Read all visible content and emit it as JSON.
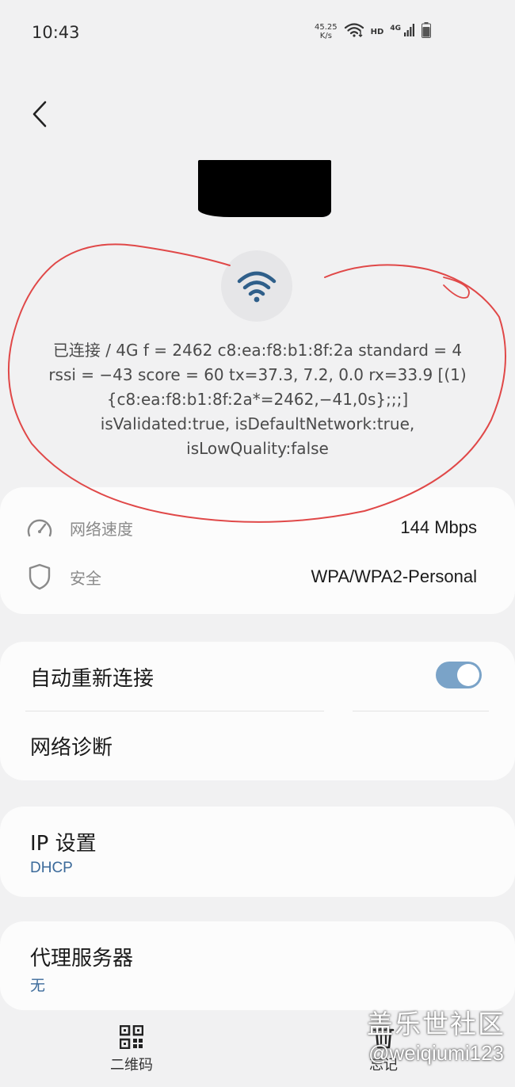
{
  "status_bar": {
    "time": "10:43",
    "net_speed_value": "45.25",
    "net_speed_unit": "K/s",
    "hd_label": "HD",
    "network_type": "4G"
  },
  "network": {
    "debug_lines": [
      "已连接 / 4G f = 2462 c8:ea:f8:b1:8f:2a standard = 4",
      "rssi = −43 score = 60  tx=37.3, 7.2, 0.0  rx=33.9 [(1)",
      "{c8:ea:f8:b1:8f:2a*=2462,−41,0s};;;]",
      "isValidated:true, isDefaultNetwork:true,",
      "isLowQuality:false"
    ]
  },
  "info": {
    "speed_label": "网络速度",
    "speed_value": "144 Mbps",
    "security_label": "安全",
    "security_value": "WPA/WPA2-Personal"
  },
  "options": {
    "auto_reconnect_label": "自动重新连接",
    "auto_reconnect_on": true,
    "diagnostics_label": "网络诊断"
  },
  "ip_settings": {
    "title": "IP 设置",
    "value": "DHCP"
  },
  "proxy": {
    "title": "代理服务器",
    "value": "无"
  },
  "bottom_bar": {
    "qr_label": "二维码",
    "forget_label": "忘记"
  },
  "watermark": {
    "title": "盖乐世社区",
    "handle": "@weiqiumi123"
  },
  "colors": {
    "background": "#f1f1f2",
    "card": "#fcfcfc",
    "toggle_on": "#7aa3c8",
    "link_blue": "#3b6a9a",
    "annotation_red": "#e04848"
  }
}
